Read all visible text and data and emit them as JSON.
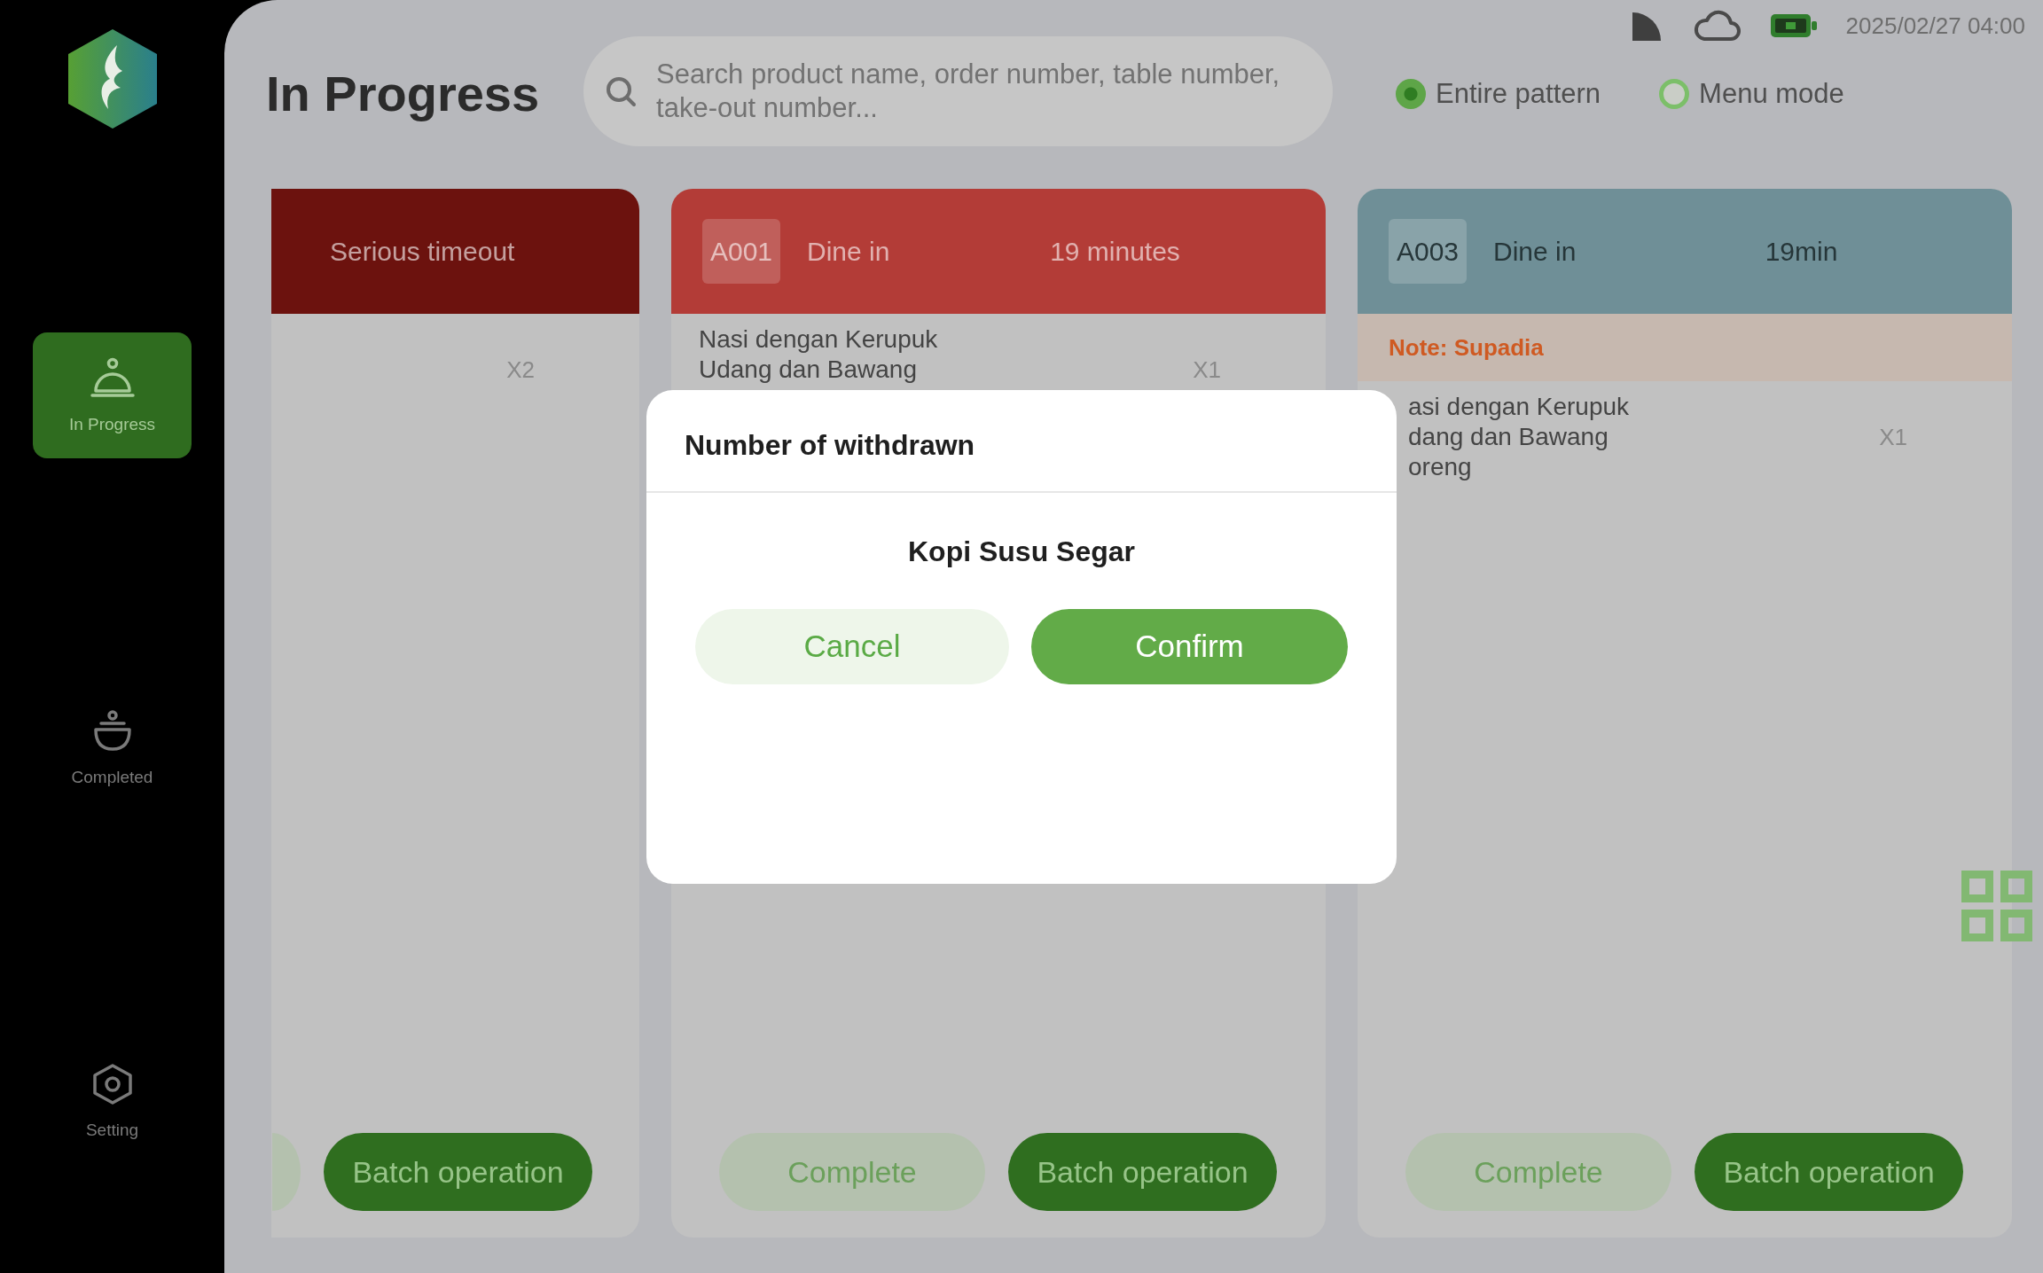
{
  "sidebar": {
    "items": [
      {
        "label": "In Progress",
        "selected": true
      },
      {
        "label": "Completed",
        "selected": false
      },
      {
        "label": "Setting",
        "selected": false
      }
    ]
  },
  "header": {
    "title": "In Progress",
    "search": {
      "placeholder": "Search product name, order number, table number, take-out number..."
    },
    "modes": [
      {
        "label": "Entire pattern",
        "selected": true
      },
      {
        "label": "Menu mode",
        "selected": false
      }
    ]
  },
  "status_bar": {
    "time": "2025/02/27 04:00"
  },
  "orders": [
    {
      "color": "#6c120e",
      "label": "Serious timeout",
      "items": [
        {
          "qty": "X2"
        }
      ],
      "buttons": [
        {
          "kind": "clipped"
        },
        {
          "kind": "primary",
          "label": "Batch operation"
        }
      ]
    },
    {
      "color": "#b33c37",
      "number": "A001",
      "type": "Dine in",
      "elapsed": "19 minutes",
      "items": [
        {
          "name": "Nasi dengan Kerupuk\nUdang dan Bawang",
          "qty": "X1"
        }
      ],
      "buttons": [
        {
          "kind": "secondary",
          "label": "Complete"
        },
        {
          "kind": "primary",
          "label": "Batch operation"
        }
      ]
    },
    {
      "color": "#6f8f97",
      "number": "A003",
      "type": "Dine in",
      "elapsed": "19min",
      "note": "Note: Supadia",
      "items": [
        {
          "name": "asi dengan Kerupuk\ndang dan Bawang\noreng",
          "qty": "X1"
        }
      ],
      "buttons": [
        {
          "kind": "secondary",
          "label": "Complete"
        },
        {
          "kind": "primary",
          "label": "Batch operation"
        }
      ]
    }
  ],
  "dialog": {
    "title": "Number of withdrawn",
    "product": "Kopi Susu Segar",
    "buttons": [
      {
        "kind": "secondary",
        "label": "Cancel"
      },
      {
        "kind": "primary",
        "label": "Confirm"
      }
    ]
  }
}
